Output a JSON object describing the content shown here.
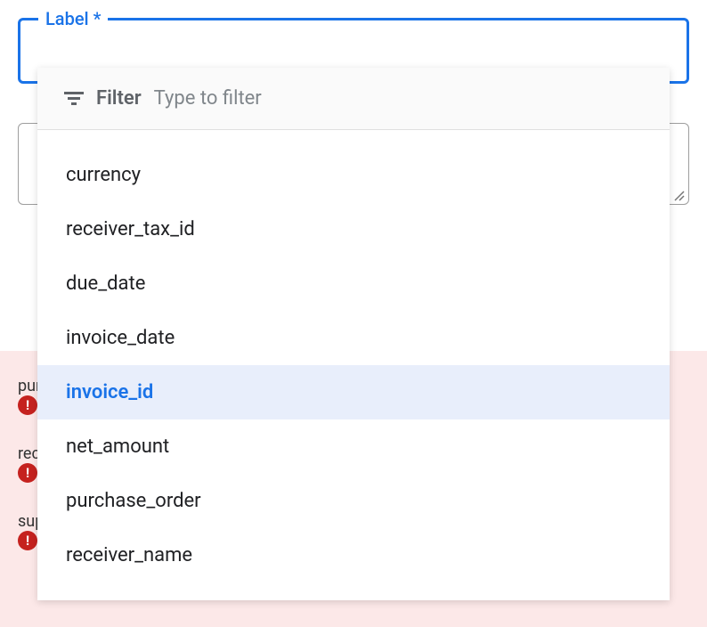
{
  "labelField": {
    "label": "Label *"
  },
  "dropdown": {
    "filter": {
      "label": "Filter",
      "placeholder": "Type to filter"
    },
    "items": [
      {
        "value": "currency",
        "selected": false
      },
      {
        "value": "receiver_tax_id",
        "selected": false
      },
      {
        "value": "due_date",
        "selected": false
      },
      {
        "value": "invoice_date",
        "selected": false
      },
      {
        "value": "invoice_id",
        "selected": true
      },
      {
        "value": "net_amount",
        "selected": false
      },
      {
        "value": "purchase_order",
        "selected": false
      },
      {
        "value": "receiver_name",
        "selected": false
      }
    ]
  },
  "errors": [
    {
      "label": "pur"
    },
    {
      "label": "rec"
    },
    {
      "label": "sup"
    }
  ]
}
